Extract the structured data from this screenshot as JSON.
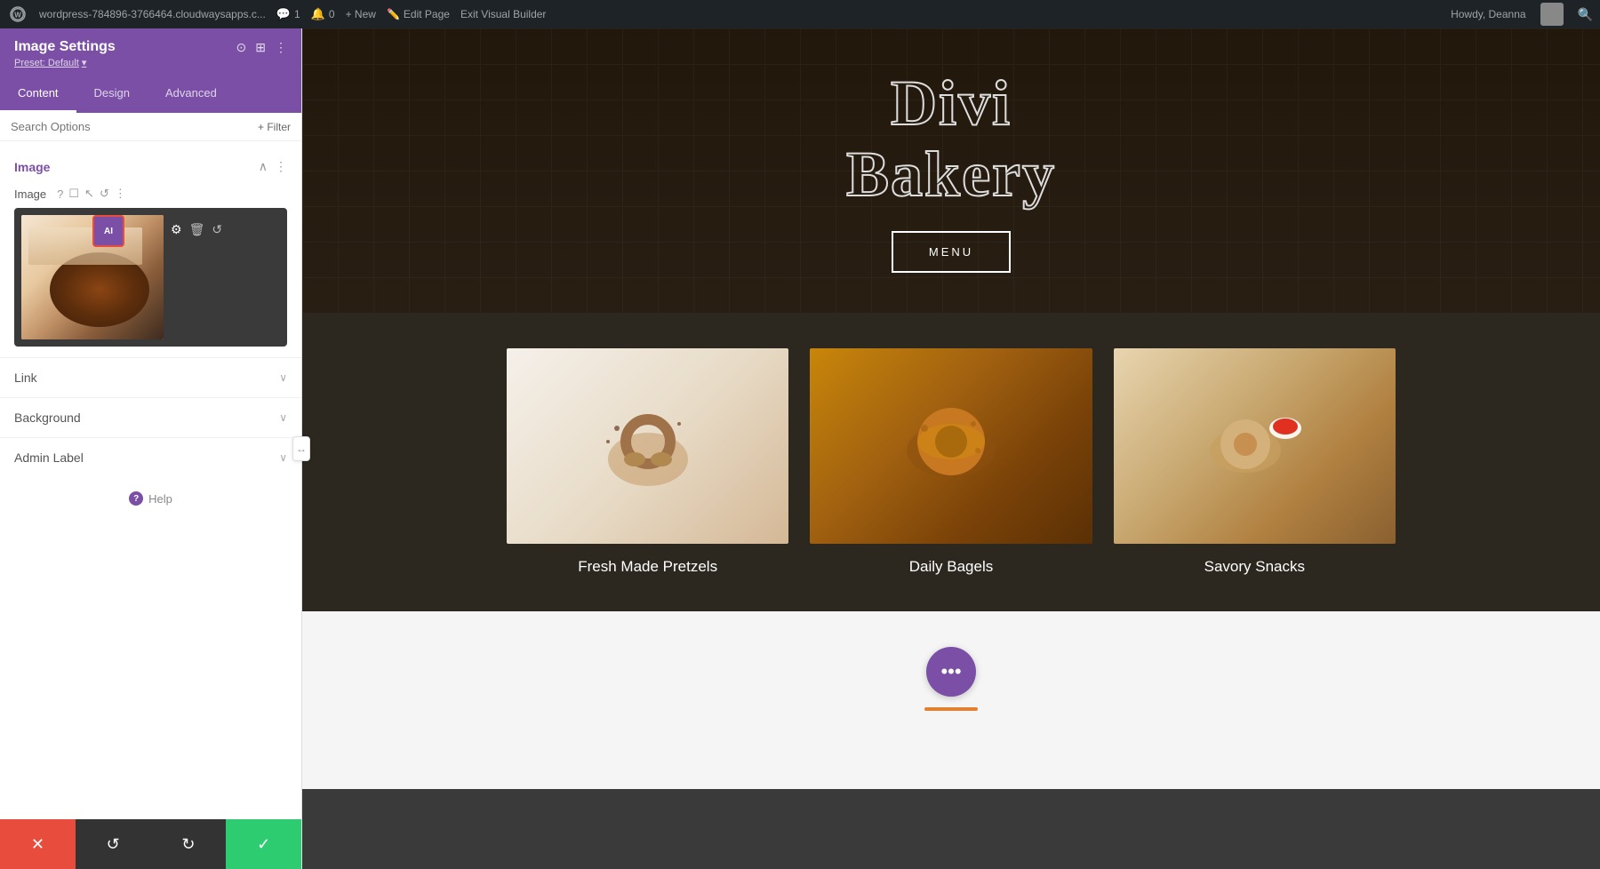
{
  "adminBar": {
    "wpLogoLabel": "W",
    "siteUrl": "wordpress-784896-3766464.cloudwaysapps.c...",
    "commentCount": "1",
    "notifCount": "0",
    "newLabel": "+ New",
    "editPageLabel": "Edit Page",
    "exitBuilderLabel": "Exit Visual Builder",
    "howdy": "Howdy, Deanna"
  },
  "panel": {
    "title": "Image Settings",
    "presetLabel": "Preset: Default",
    "presetChevron": "▾",
    "tabs": [
      {
        "id": "content",
        "label": "Content",
        "active": true
      },
      {
        "id": "design",
        "label": "Design",
        "active": false
      },
      {
        "id": "advanced",
        "label": "Advanced",
        "active": false
      }
    ],
    "search": {
      "placeholder": "Search Options",
      "filterLabel": "+ Filter"
    },
    "imageSectionTitle": "Image",
    "imageFieldLabel": "Image",
    "aiBadgeLabel": "AI",
    "collapsibleSections": [
      {
        "id": "link",
        "label": "Link"
      },
      {
        "id": "background",
        "label": "Background"
      },
      {
        "id": "admin-label",
        "label": "Admin Label"
      }
    ],
    "helpLabel": "Help"
  },
  "bottomBar": {
    "cancelLabel": "✕",
    "undoLabel": "↺",
    "redoLabel": "↻",
    "saveLabel": "✓"
  },
  "canvas": {
    "hero": {
      "titleLine1": "Divi",
      "titleLine2": "Bakery",
      "menuButtonLabel": "MENU"
    },
    "products": [
      {
        "id": "fresh-pretzels",
        "label": "Fresh Made Pretzels",
        "emoji": "🥨"
      },
      {
        "id": "daily-bagels",
        "label": "Daily Bagels",
        "emoji": "🥯"
      },
      {
        "id": "savory-snacks",
        "label": "Savory Snacks",
        "emoji": "🥐"
      }
    ],
    "chatBubbleLabel": "•••"
  }
}
